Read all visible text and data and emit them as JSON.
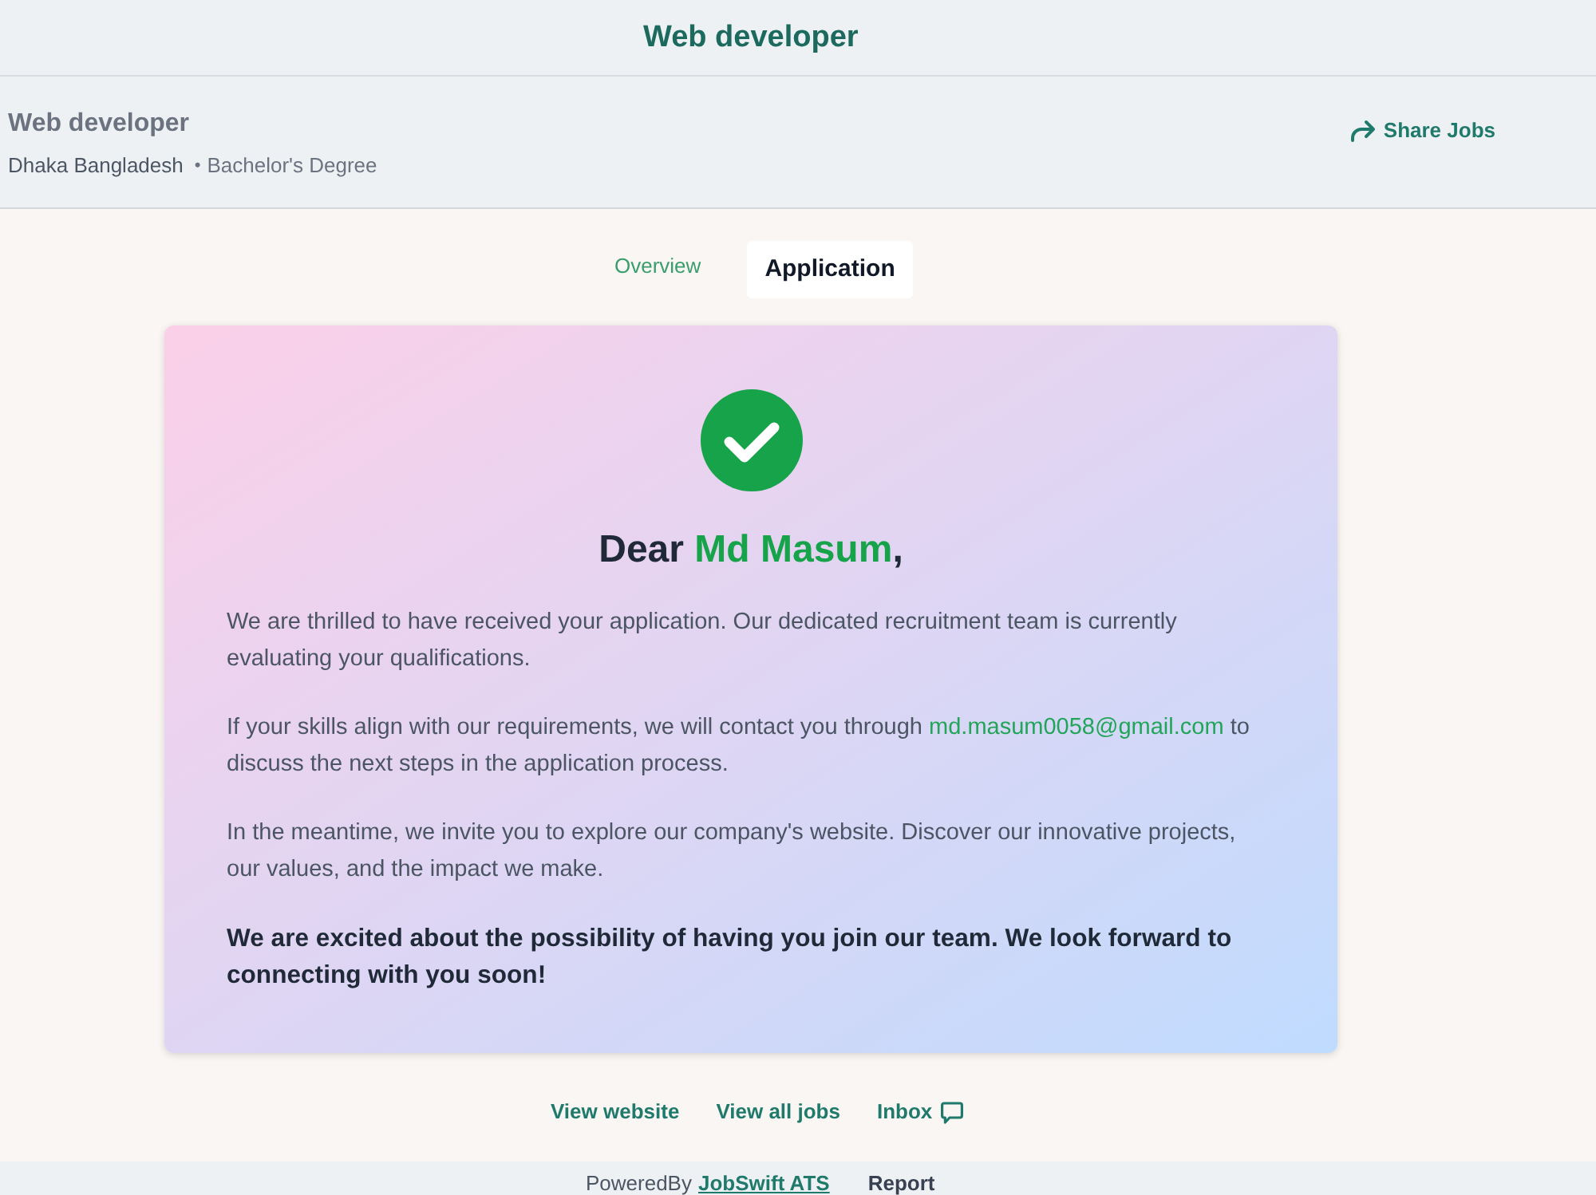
{
  "page_title": "Web developer",
  "job": {
    "title": "Web developer",
    "location": "Dhaka Bangladesh",
    "separator": "•",
    "degree": "Bachelor's Degree",
    "share_label": "Share Jobs"
  },
  "tabs": [
    {
      "label": "Overview",
      "selected": false
    },
    {
      "label": "Application",
      "selected": true
    }
  ],
  "confirmation": {
    "greeting": {
      "prefix": "Dear",
      "name": "Md Masum",
      "suffix": ","
    },
    "paragraphs": [
      {
        "kind": "plain",
        "text": "We are thrilled to have received your application. Our dedicated recruitment team is currently evaluating your qualifications."
      },
      {
        "kind": "contact",
        "before": "If your skills align with our requirements, we will contact you through",
        "email": "md.masum0058@gmail.com",
        "after": "to discuss the next steps in the application process."
      },
      {
        "kind": "plain",
        "text": "In the meantime, we invite you to explore our company's website. Discover our innovative projects, our values, and the impact we make."
      },
      {
        "kind": "emphasis",
        "text": "We are excited about the possibility of having you join our team. We look forward to connecting with you soon!"
      }
    ]
  },
  "footer_links": [
    {
      "kind": "text",
      "label": "View website"
    },
    {
      "kind": "text",
      "label": "View all jobs"
    },
    {
      "kind": "chat",
      "label": "Inbox"
    }
  ],
  "bottom_bar": {
    "powered_by": "PoweredBy",
    "brand": "JobSwift ATS",
    "report": "Report"
  }
}
